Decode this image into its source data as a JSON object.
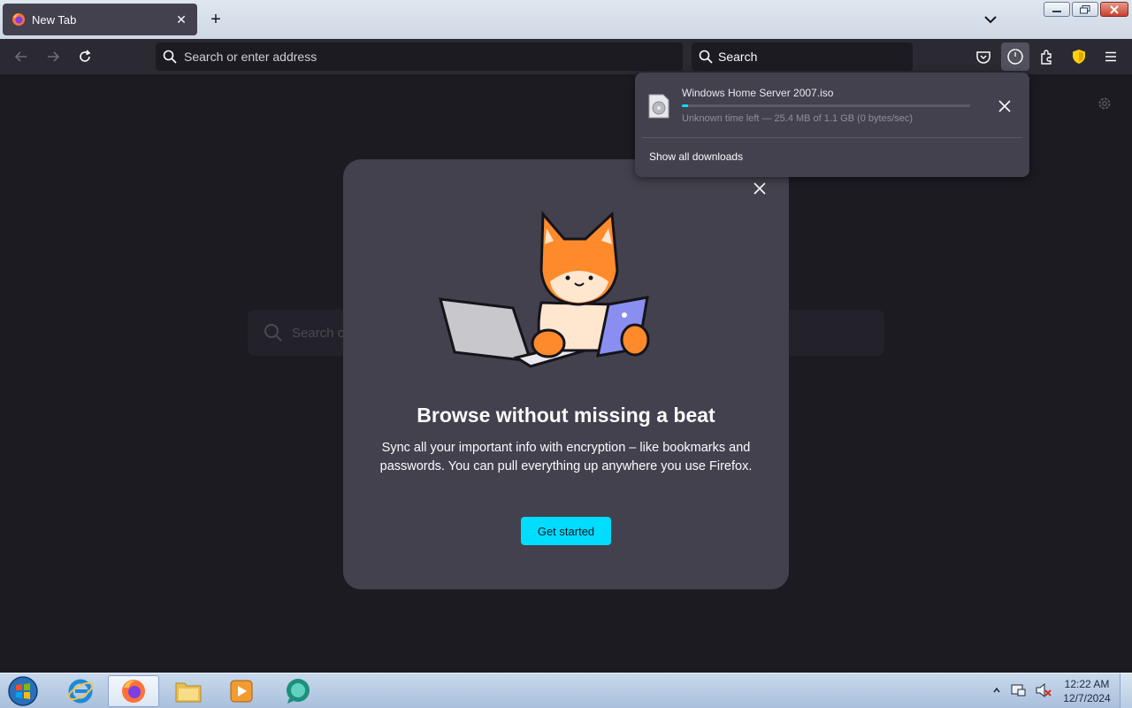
{
  "window": {
    "tab_title": "New Tab",
    "tab_close": "✕",
    "new_tab": "+"
  },
  "navbar": {
    "url_placeholder": "Search or enter address",
    "search_placeholder": "Search"
  },
  "content": {
    "bg_search_placeholder": "Search or enter address"
  },
  "downloads": {
    "filename": "Windows Home Server 2007.iso",
    "status": "Unknown time left — 25.4 MB of 1.1 GB (0 bytes/sec)",
    "progress_fraction": 0.02,
    "show_all": "Show all downloads"
  },
  "modal": {
    "title": "Browse without missing a beat",
    "description": "Sync all your important info with encryption – like bookmarks and passwords. You can pull everything up anywhere you use Firefox.",
    "cta": "Get started"
  },
  "taskbar": {
    "time": "12:22 AM",
    "date": "12/7/2024",
    "apps": [
      "internet-explorer",
      "firefox",
      "file-explorer",
      "media-player",
      "chat-app"
    ]
  },
  "colors": {
    "accent": "#00ddff",
    "panel": "#42414d",
    "toolbar": "#2b2a33",
    "content_bg": "#1c1b22"
  }
}
